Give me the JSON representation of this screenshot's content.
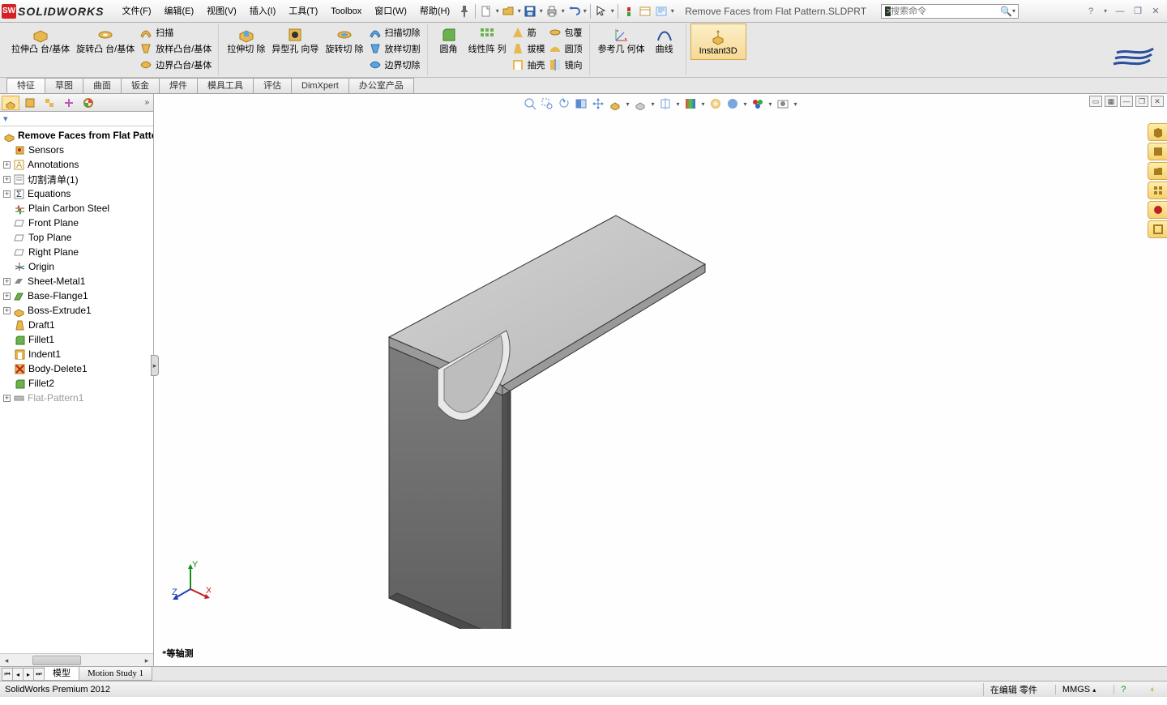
{
  "brand": "SOLIDWORKS",
  "menus": [
    "文件(F)",
    "编辑(E)",
    "视图(V)",
    "插入(I)",
    "工具(T)",
    "Toolbox",
    "窗口(W)",
    "帮助(H)"
  ],
  "doc_title": "Remove Faces from Flat Pattern.SLDPRT",
  "search_placeholder": "搜索命令",
  "ribbon": {
    "g1": {
      "extrude": "拉伸凸\n台/基体",
      "revolve": "旋转凸\n台/基体",
      "sweep": "扫描",
      "loft": "放样凸台/基体",
      "boundary": "边界凸台/基体"
    },
    "g2": {
      "cut_extrude": "拉伸切\n除",
      "hole": "异型孔\n向导",
      "cut_rev": "旋转切\n除",
      "sweep_cut": "扫描切除",
      "loft_cut": "放样切割",
      "boundary_cut": "边界切除"
    },
    "g3": {
      "fillet": "圆角",
      "pattern": "线性阵\n列",
      "rib": "筋",
      "draft": "拔模",
      "shell": "抽壳",
      "wrap": "包覆",
      "dome": "圆顶",
      "mirror": "镜向"
    },
    "g4": {
      "refgeo": "参考几\n何体",
      "curves": "曲线"
    },
    "instant3d": "Instant3D"
  },
  "tabs": [
    "特征",
    "草图",
    "曲面",
    "钣金",
    "焊件",
    "模具工具",
    "评估",
    "DimXpert",
    "办公室产品"
  ],
  "active_tab": 0,
  "tree_root": "Remove Faces from Flat Patter",
  "tree": [
    {
      "icon": "sensor",
      "label": "Sensors",
      "indent": 1
    },
    {
      "icon": "annot",
      "label": "Annotations",
      "indent": 1,
      "exp": "+"
    },
    {
      "icon": "cutlist",
      "label": "切割清单(1)",
      "indent": 1,
      "exp": "+"
    },
    {
      "icon": "eq",
      "label": "Equations",
      "indent": 1,
      "exp": "+"
    },
    {
      "icon": "mat",
      "label": "Plain Carbon Steel",
      "indent": 1
    },
    {
      "icon": "plane",
      "label": "Front Plane",
      "indent": 1
    },
    {
      "icon": "plane",
      "label": "Top Plane",
      "indent": 1
    },
    {
      "icon": "plane",
      "label": "Right Plane",
      "indent": 1
    },
    {
      "icon": "origin",
      "label": "Origin",
      "indent": 1
    },
    {
      "icon": "sheetmetal",
      "label": "Sheet-Metal1",
      "indent": 1,
      "exp": "+"
    },
    {
      "icon": "flange",
      "label": "Base-Flange1",
      "indent": 1,
      "exp": "+"
    },
    {
      "icon": "boss",
      "label": "Boss-Extrude1",
      "indent": 1,
      "exp": "+"
    },
    {
      "icon": "draft",
      "label": "Draft1",
      "indent": 1
    },
    {
      "icon": "fillet",
      "label": "Fillet1",
      "indent": 1
    },
    {
      "icon": "indent",
      "label": "Indent1",
      "indent": 1
    },
    {
      "icon": "del",
      "label": "Body-Delete1",
      "indent": 1
    },
    {
      "icon": "fillet",
      "label": "Fillet2",
      "indent": 1
    },
    {
      "icon": "flatpat",
      "label": "Flat-Pattern1",
      "indent": 1,
      "exp": "+",
      "suppressed": true
    }
  ],
  "bottom_tabs": [
    "模型",
    "Motion Study 1"
  ],
  "view_name": "*等轴测",
  "status_left": "SolidWorks Premium 2012",
  "status_edit": "在编辑  零件",
  "status_units": "MMGS",
  "triad": {
    "x": "X",
    "y": "Y",
    "z": "Z"
  },
  "colors": {
    "accent": "#f6d26f",
    "red": "#d42027",
    "blue": "#2a4f9e"
  }
}
